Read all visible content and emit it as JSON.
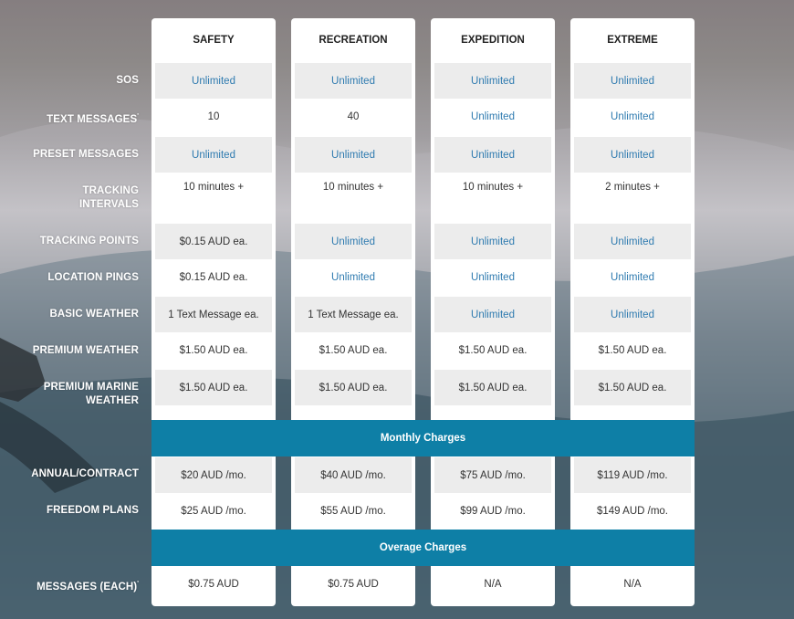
{
  "plans": [
    "SAFETY",
    "RECREATION",
    "EXPEDITION",
    "EXTREME"
  ],
  "row_labels": {
    "sos": "SOS",
    "text_messages": "TEXT MESSAGES",
    "preset_messages": "PRESET MESSAGES",
    "tracking_intervals": "TRACKING INTERVALS",
    "tracking_points": "TRACKING POINTS",
    "location_pings": "LOCATION PINGS",
    "basic_weather": "BASIC WEATHER",
    "premium_weather": "PREMIUM WEATHER",
    "premium_marine_weather": "PREMIUM MARINE WEATHER",
    "annual_contract": "ANNUAL/CONTRACT",
    "freedom_plans": "FREEDOM PLANS",
    "messages_each": "MESSAGES (EACH)"
  },
  "footnote_mark": "'",
  "sections": {
    "monthly": "Monthly Charges",
    "overage": "Overage Charges"
  },
  "values": {
    "safety": {
      "sos": "Unlimited",
      "text_messages": "10",
      "preset_messages": "Unlimited",
      "tracking_intervals": "10 minutes +",
      "tracking_points": "$0.15 AUD ea.",
      "location_pings": "$0.15 AUD ea.",
      "basic_weather": "1 Text Message ea.",
      "premium_weather": "$1.50 AUD ea.",
      "premium_marine_weather": "$1.50 AUD ea.",
      "annual_contract": "$20 AUD /mo.",
      "freedom_plans": "$25 AUD /mo.",
      "messages_each": "$0.75 AUD"
    },
    "recreation": {
      "sos": "Unlimited",
      "text_messages": "40",
      "preset_messages": "Unlimited",
      "tracking_intervals": "10 minutes +",
      "tracking_points": "Unlimited",
      "location_pings": "Unlimited",
      "basic_weather": "1 Text Message ea.",
      "premium_weather": "$1.50 AUD ea.",
      "premium_marine_weather": "$1.50 AUD ea.",
      "annual_contract": "$40 AUD /mo.",
      "freedom_plans": "$55 AUD /mo.",
      "messages_each": "$0.75 AUD"
    },
    "expedition": {
      "sos": "Unlimited",
      "text_messages": "Unlimited",
      "preset_messages": "Unlimited",
      "tracking_intervals": "10 minutes +",
      "tracking_points": "Unlimited",
      "location_pings": "Unlimited",
      "basic_weather": "Unlimited",
      "premium_weather": "$1.50 AUD ea.",
      "premium_marine_weather": "$1.50 AUD ea.",
      "annual_contract": "$75 AUD /mo.",
      "freedom_plans": "$99 AUD /mo.",
      "messages_each": "N/A"
    },
    "extreme": {
      "sos": "Unlimited",
      "text_messages": "Unlimited",
      "preset_messages": "Unlimited",
      "tracking_intervals": "2 minutes +",
      "tracking_points": "Unlimited",
      "location_pings": "Unlimited",
      "basic_weather": "Unlimited",
      "premium_weather": "$1.50 AUD ea.",
      "premium_marine_weather": "$1.50 AUD ea.",
      "annual_contract": "$119 AUD /mo.",
      "freedom_plans": "$149 AUD /mo.",
      "messages_each": "N/A"
    }
  },
  "colors": {
    "accent": "#0e7fa6",
    "link": "#2f7bb0",
    "shade": "#ececec"
  }
}
